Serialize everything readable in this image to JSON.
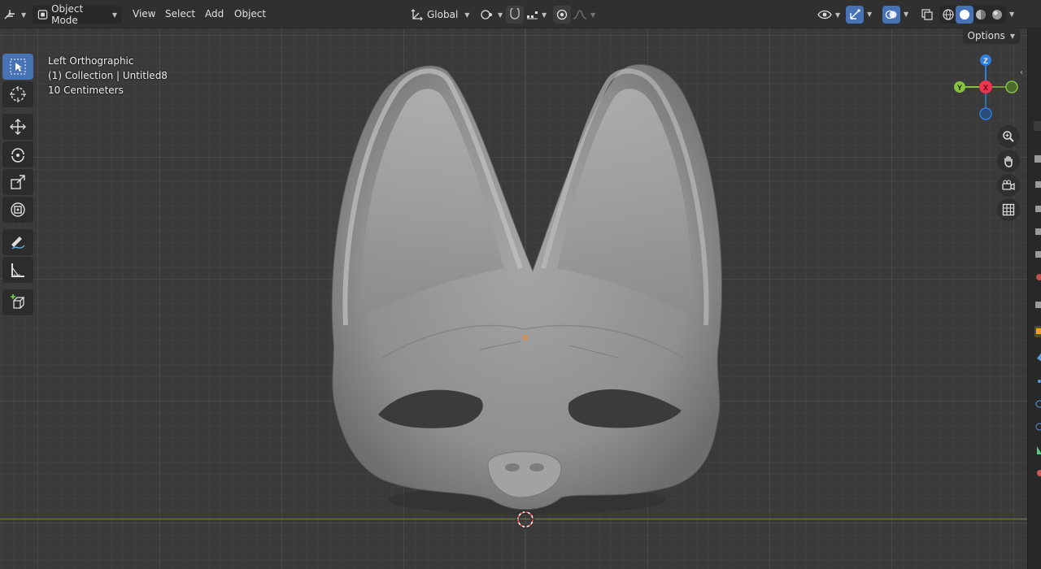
{
  "header": {
    "mode": "Object Mode",
    "menus": [
      "View",
      "Select",
      "Add",
      "Object"
    ],
    "transform_orientation": "Global"
  },
  "viewport": {
    "view_name": "Left Orthographic",
    "collection": "(1) Collection | Untitled8",
    "scale": "10 Centimeters",
    "options_label": "Options"
  },
  "gizmo": {
    "z_label": "Z",
    "y_label": "Y",
    "x_label": "X",
    "colors": {
      "z": "#2f7fe0",
      "y": "#86c23b",
      "x": "#f0344f"
    }
  },
  "toolbar": {
    "tools": [
      "select-box",
      "cursor",
      "move",
      "rotate",
      "scale",
      "transform",
      "annotate",
      "measure",
      "add-cube"
    ],
    "active": "select-box"
  },
  "accent_color": "#4772b3"
}
